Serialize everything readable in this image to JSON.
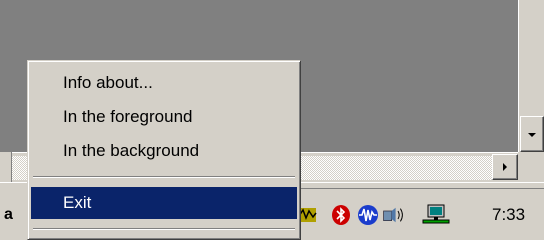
{
  "window": {
    "scrollbar_down_icon": "arrow-down-icon",
    "scrollbar_right_icon": "arrow-right-icon"
  },
  "taskbar": {
    "fragment_text": "a",
    "tray_icons": [
      "network-activity-icon",
      "bluetooth-icon",
      "audio-wave-icon",
      "volume-icon",
      "network-connection-icon"
    ],
    "clock": "7:33"
  },
  "context_menu": {
    "items": [
      {
        "label": "Info about..."
      },
      {
        "label": "In the foreground"
      },
      {
        "label": "In the background"
      },
      {
        "label": "Exit"
      }
    ],
    "highlight_color": "#0a246a"
  },
  "colors": {
    "face": "#d4d0c8",
    "desktop": "#808080",
    "highlight": "#0a246a"
  }
}
